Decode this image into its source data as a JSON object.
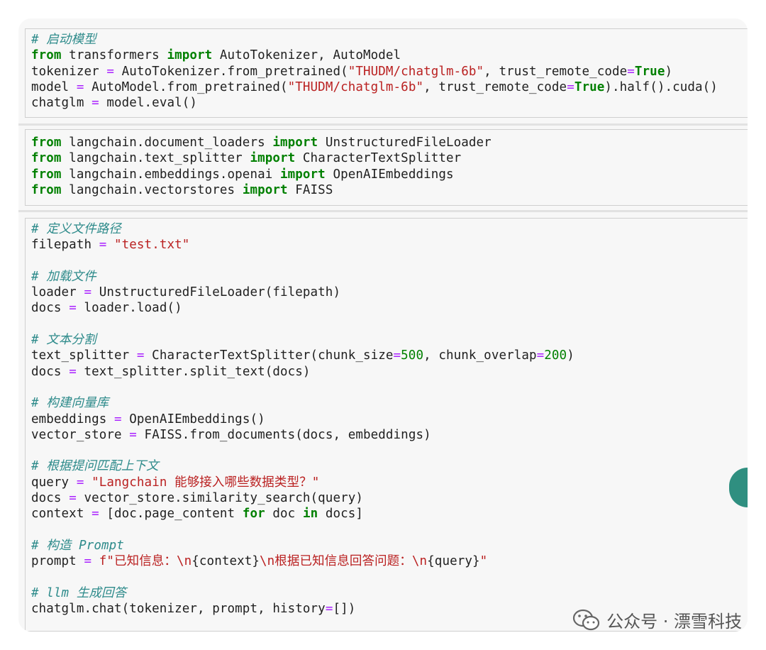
{
  "cells": [
    {
      "lines": [
        [
          {
            "t": "# 启动模型",
            "c": "cm"
          }
        ],
        [
          {
            "t": "from",
            "c": "kw"
          },
          {
            "t": " transformers "
          },
          {
            "t": "import",
            "c": "kw"
          },
          {
            "t": " AutoTokenizer, AutoModel"
          }
        ],
        [
          {
            "t": "tokenizer "
          },
          {
            "t": "=",
            "c": "op"
          },
          {
            "t": " AutoTokenizer.from_pretrained("
          },
          {
            "t": "\"THUDM/chatglm-6b\"",
            "c": "st"
          },
          {
            "t": ", trust_remote_code"
          },
          {
            "t": "=",
            "c": "op"
          },
          {
            "t": "True",
            "c": "kw"
          },
          {
            "t": ")"
          }
        ],
        [
          {
            "t": "model "
          },
          {
            "t": "=",
            "c": "op"
          },
          {
            "t": " AutoModel.from_pretrained("
          },
          {
            "t": "\"THUDM/chatglm-6b\"",
            "c": "st"
          },
          {
            "t": ", trust_remote_code"
          },
          {
            "t": "=",
            "c": "op"
          },
          {
            "t": "True",
            "c": "kw"
          },
          {
            "t": ").half().cuda()"
          }
        ],
        [
          {
            "t": "chatglm "
          },
          {
            "t": "=",
            "c": "op"
          },
          {
            "t": " model.eval()"
          }
        ]
      ]
    },
    {
      "lines": [
        [
          {
            "t": "from",
            "c": "kw"
          },
          {
            "t": " langchain.document_loaders "
          },
          {
            "t": "import",
            "c": "kw"
          },
          {
            "t": " UnstructuredFileLoader"
          }
        ],
        [
          {
            "t": "from",
            "c": "kw"
          },
          {
            "t": " langchain.text_splitter "
          },
          {
            "t": "import",
            "c": "kw"
          },
          {
            "t": " CharacterTextSplitter"
          }
        ],
        [
          {
            "t": "from",
            "c": "kw"
          },
          {
            "t": " langchain.embeddings.openai "
          },
          {
            "t": "import",
            "c": "kw"
          },
          {
            "t": " OpenAIEmbeddings"
          }
        ],
        [
          {
            "t": "from",
            "c": "kw"
          },
          {
            "t": " langchain.vectorstores "
          },
          {
            "t": "import",
            "c": "kw"
          },
          {
            "t": " FAISS"
          }
        ]
      ]
    },
    {
      "lines": [
        [
          {
            "t": "# 定义文件路径",
            "c": "cm"
          }
        ],
        [
          {
            "t": "filepath "
          },
          {
            "t": "=",
            "c": "op"
          },
          {
            "t": " "
          },
          {
            "t": "\"test.txt\"",
            "c": "st"
          }
        ],
        [],
        [
          {
            "t": "# 加载文件",
            "c": "cm"
          }
        ],
        [
          {
            "t": "loader "
          },
          {
            "t": "=",
            "c": "op"
          },
          {
            "t": " UnstructuredFileLoader(filepath)"
          }
        ],
        [
          {
            "t": "docs "
          },
          {
            "t": "=",
            "c": "op"
          },
          {
            "t": " loader.load()"
          }
        ],
        [],
        [
          {
            "t": "# 文本分割",
            "c": "cm"
          }
        ],
        [
          {
            "t": "text_splitter "
          },
          {
            "t": "=",
            "c": "op"
          },
          {
            "t": " CharacterTextSplitter(chunk_size"
          },
          {
            "t": "=",
            "c": "op"
          },
          {
            "t": "500",
            "c": "nu"
          },
          {
            "t": ", chunk_overlap"
          },
          {
            "t": "=",
            "c": "op"
          },
          {
            "t": "200",
            "c": "nu"
          },
          {
            "t": ")"
          }
        ],
        [
          {
            "t": "docs "
          },
          {
            "t": "=",
            "c": "op"
          },
          {
            "t": " text_splitter.split_text(docs)"
          }
        ],
        [],
        [
          {
            "t": "# 构建向量库",
            "c": "cm"
          }
        ],
        [
          {
            "t": "embeddings "
          },
          {
            "t": "=",
            "c": "op"
          },
          {
            "t": " OpenAIEmbeddings()"
          }
        ],
        [
          {
            "t": "vector_store "
          },
          {
            "t": "=",
            "c": "op"
          },
          {
            "t": " FAISS.from_documents(docs, embeddings)"
          }
        ],
        [],
        [
          {
            "t": "# 根据提问匹配上下文",
            "c": "cm"
          }
        ],
        [
          {
            "t": "query "
          },
          {
            "t": "=",
            "c": "op"
          },
          {
            "t": " "
          },
          {
            "t": "\"Langchain 能够接入哪些数据类型？\"",
            "c": "st"
          }
        ],
        [
          {
            "t": "docs "
          },
          {
            "t": "=",
            "c": "op"
          },
          {
            "t": " vector_store.similarity_search(query)"
          }
        ],
        [
          {
            "t": "context "
          },
          {
            "t": "=",
            "c": "op"
          },
          {
            "t": " [doc.page_content "
          },
          {
            "t": "for",
            "c": "kw"
          },
          {
            "t": " doc "
          },
          {
            "t": "in",
            "c": "kw"
          },
          {
            "t": " docs]"
          }
        ],
        [],
        [
          {
            "t": "# 构造 Prompt",
            "c": "cm"
          }
        ],
        [
          {
            "t": "prompt "
          },
          {
            "t": "=",
            "c": "op"
          },
          {
            "t": " "
          },
          {
            "t": "f\"已知信息：\\n",
            "c": "st"
          },
          {
            "t": "{context}"
          },
          {
            "t": "\\n根据已知信息回答问题：\\n",
            "c": "st"
          },
          {
            "t": "{query}"
          },
          {
            "t": "\"",
            "c": "st"
          }
        ],
        [],
        [
          {
            "t": "# llm 生成回答",
            "c": "cm"
          }
        ],
        [
          {
            "t": "chatglm.chat(tokenizer, prompt, history"
          },
          {
            "t": "=",
            "c": "op"
          },
          {
            "t": "[])"
          }
        ]
      ]
    }
  ],
  "watermark": {
    "text": "公众号 · 漂雪科技",
    "icon": "wechat-icon"
  },
  "colors": {
    "comment": "#2e8b8b",
    "keyword": "#008000",
    "string": "#ba2121",
    "operator": "#aa22ff",
    "accent_blob": "#2f8f80"
  }
}
